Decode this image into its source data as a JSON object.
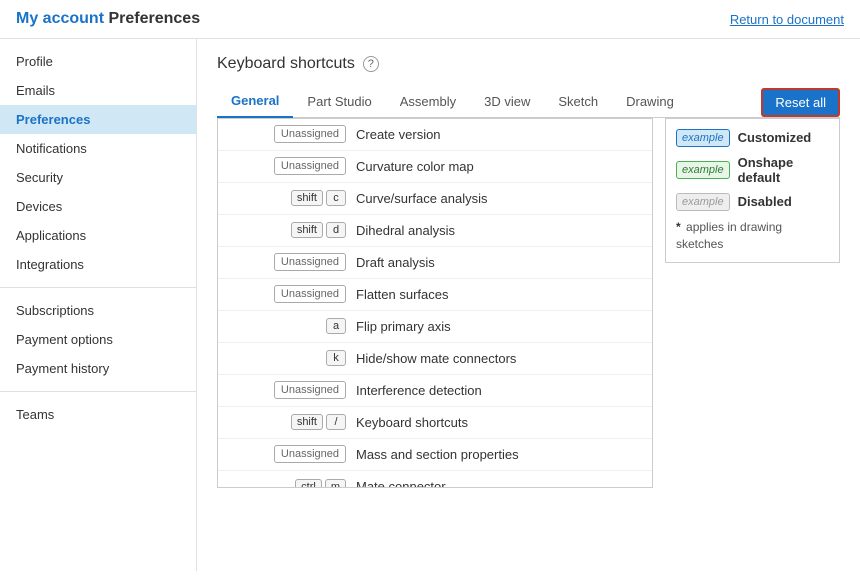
{
  "header": {
    "my_account_label": "My account",
    "separator": " ",
    "page_name": "Preferences",
    "return_link": "Return to document"
  },
  "sidebar": {
    "items": [
      {
        "label": "Profile",
        "id": "profile",
        "active": false
      },
      {
        "label": "Emails",
        "id": "emails",
        "active": false
      },
      {
        "label": "Preferences",
        "id": "preferences",
        "active": true
      },
      {
        "label": "Notifications",
        "id": "notifications",
        "active": false
      },
      {
        "label": "Security",
        "id": "security",
        "active": false
      },
      {
        "label": "Devices",
        "id": "devices",
        "active": false
      },
      {
        "label": "Applications",
        "id": "applications",
        "active": false
      },
      {
        "label": "Integrations",
        "id": "integrations",
        "active": false
      }
    ],
    "items2": [
      {
        "label": "Subscriptions",
        "id": "subscriptions"
      },
      {
        "label": "Payment options",
        "id": "payment-options"
      },
      {
        "label": "Payment history",
        "id": "payment-history"
      }
    ],
    "items3": [
      {
        "label": "Teams",
        "id": "teams"
      }
    ]
  },
  "main": {
    "section_title": "Keyboard shortcuts",
    "reset_btn": "Reset all",
    "tabs": [
      {
        "label": "General",
        "active": true
      },
      {
        "label": "Part Studio",
        "active": false
      },
      {
        "label": "Assembly",
        "active": false
      },
      {
        "label": "3D view",
        "active": false
      },
      {
        "label": "Sketch",
        "active": false
      },
      {
        "label": "Drawing",
        "active": false
      }
    ],
    "shortcuts": [
      {
        "keys": [
          "Unassigned"
        ],
        "action": "Create version",
        "type": "unassigned"
      },
      {
        "keys": [
          "Unassigned"
        ],
        "action": "Curvature color map",
        "type": "unassigned"
      },
      {
        "keys": [
          "shift",
          "c"
        ],
        "action": "Curve/surface analysis",
        "type": "keys"
      },
      {
        "keys": [
          "shift",
          "d"
        ],
        "action": "Dihedral analysis",
        "type": "keys"
      },
      {
        "keys": [
          "Unassigned"
        ],
        "action": "Draft analysis",
        "type": "unassigned"
      },
      {
        "keys": [
          "Unassigned"
        ],
        "action": "Flatten surfaces",
        "type": "unassigned"
      },
      {
        "keys": [
          "a"
        ],
        "action": "Flip primary axis",
        "type": "keys"
      },
      {
        "keys": [
          "k"
        ],
        "action": "Hide/show mate connectors",
        "type": "keys"
      },
      {
        "keys": [
          "Unassigned"
        ],
        "action": "Interference detection",
        "type": "unassigned"
      },
      {
        "keys": [
          "shift",
          "/"
        ],
        "action": "Keyboard shortcuts",
        "type": "keys"
      },
      {
        "keys": [
          "Unassigned"
        ],
        "action": "Mass and section properties",
        "type": "unassigned"
      },
      {
        "keys": [
          "ctrl",
          "m"
        ],
        "action": "Mate connector",
        "type": "keys"
      }
    ],
    "legend": {
      "items": [
        {
          "style": "customized",
          "label": "Customized"
        },
        {
          "style": "default",
          "label": "Onshape default"
        },
        {
          "style": "disabled",
          "label": "Disabled"
        }
      ],
      "note": "applies in drawing sketches"
    }
  }
}
